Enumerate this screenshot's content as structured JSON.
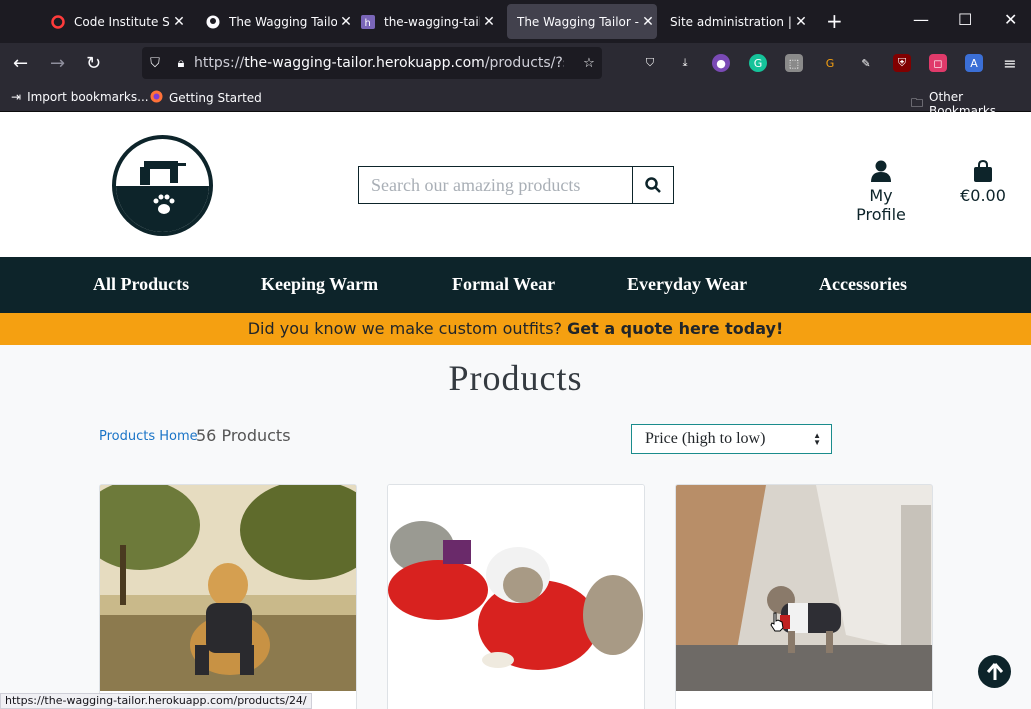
{
  "browser": {
    "tabs": [
      {
        "title": "Code Institute Scho",
        "icon": "opera-icon",
        "active": false
      },
      {
        "title": "The Wagging Tailo",
        "icon": "github-icon",
        "active": false
      },
      {
        "title": "the-wagging-tailo",
        "icon": "heroku-icon",
        "active": false
      },
      {
        "title": "The Wagging Tailor - (",
        "icon": "none",
        "active": true
      },
      {
        "title": "Site administration | Dj",
        "icon": "none",
        "active": false
      }
    ],
    "url_prefix": "https://",
    "url_host": "the-wagging-tailor.herokuapp.com",
    "url_path": "/products/?sort=p",
    "bookmarks": [
      {
        "label": "Import bookmarks...",
        "icon": "import-icon"
      },
      {
        "label": "Getting Started",
        "icon": "firefox-icon"
      }
    ],
    "other_bookmarks": "Other Bookmarks",
    "status_url": "https://the-wagging-tailor.herokuapp.com/products/24/"
  },
  "header": {
    "search_placeholder": "Search our amazing products",
    "profile_label": "My Profile",
    "cart_total": "€0.00"
  },
  "nav": {
    "items": [
      "All Products",
      "Keeping Warm",
      "Formal Wear",
      "Everyday Wear",
      "Accessories"
    ]
  },
  "banner": {
    "text": "Did you know we make custom outfits?",
    "link": "Get a quote here today!"
  },
  "main": {
    "title": "Products",
    "breadcrumb": "Products Home",
    "count": "56 Products",
    "sort_selected": "Price (high to low)"
  },
  "colors": {
    "brand_dark": "#0d242a",
    "banner": "#f5a011",
    "link": "#1a74c7"
  }
}
